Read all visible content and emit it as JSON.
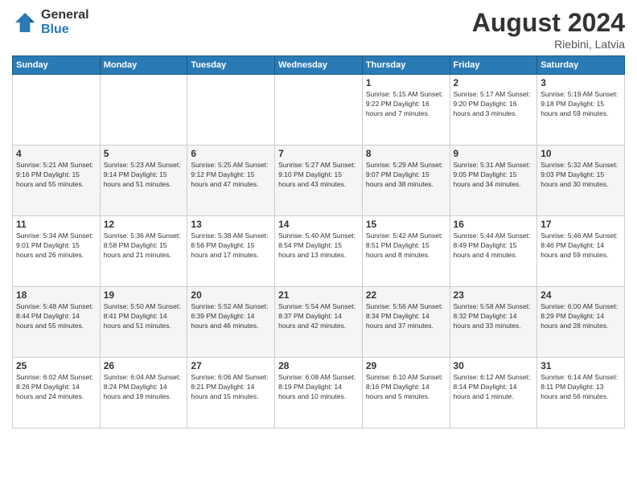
{
  "logo": {
    "general": "General",
    "blue": "Blue"
  },
  "title": {
    "month_year": "August 2024",
    "location": "Riebini, Latvia"
  },
  "headers": [
    "Sunday",
    "Monday",
    "Tuesday",
    "Wednesday",
    "Thursday",
    "Friday",
    "Saturday"
  ],
  "weeks": [
    [
      {
        "day": "",
        "info": ""
      },
      {
        "day": "",
        "info": ""
      },
      {
        "day": "",
        "info": ""
      },
      {
        "day": "",
        "info": ""
      },
      {
        "day": "1",
        "info": "Sunrise: 5:15 AM\nSunset: 9:22 PM\nDaylight: 16 hours\nand 7 minutes."
      },
      {
        "day": "2",
        "info": "Sunrise: 5:17 AM\nSunset: 9:20 PM\nDaylight: 16 hours\nand 3 minutes."
      },
      {
        "day": "3",
        "info": "Sunrise: 5:19 AM\nSunset: 9:18 PM\nDaylight: 15 hours\nand 59 minutes."
      }
    ],
    [
      {
        "day": "4",
        "info": "Sunrise: 5:21 AM\nSunset: 9:16 PM\nDaylight: 15 hours\nand 55 minutes."
      },
      {
        "day": "5",
        "info": "Sunrise: 5:23 AM\nSunset: 9:14 PM\nDaylight: 15 hours\nand 51 minutes."
      },
      {
        "day": "6",
        "info": "Sunrise: 5:25 AM\nSunset: 9:12 PM\nDaylight: 15 hours\nand 47 minutes."
      },
      {
        "day": "7",
        "info": "Sunrise: 5:27 AM\nSunset: 9:10 PM\nDaylight: 15 hours\nand 43 minutes."
      },
      {
        "day": "8",
        "info": "Sunrise: 5:29 AM\nSunset: 9:07 PM\nDaylight: 15 hours\nand 38 minutes."
      },
      {
        "day": "9",
        "info": "Sunrise: 5:31 AM\nSunset: 9:05 PM\nDaylight: 15 hours\nand 34 minutes."
      },
      {
        "day": "10",
        "info": "Sunrise: 5:32 AM\nSunset: 9:03 PM\nDaylight: 15 hours\nand 30 minutes."
      }
    ],
    [
      {
        "day": "11",
        "info": "Sunrise: 5:34 AM\nSunset: 9:01 PM\nDaylight: 15 hours\nand 26 minutes."
      },
      {
        "day": "12",
        "info": "Sunrise: 5:36 AM\nSunset: 8:58 PM\nDaylight: 15 hours\nand 21 minutes."
      },
      {
        "day": "13",
        "info": "Sunrise: 5:38 AM\nSunset: 8:56 PM\nDaylight: 15 hours\nand 17 minutes."
      },
      {
        "day": "14",
        "info": "Sunrise: 5:40 AM\nSunset: 8:54 PM\nDaylight: 15 hours\nand 13 minutes."
      },
      {
        "day": "15",
        "info": "Sunrise: 5:42 AM\nSunset: 8:51 PM\nDaylight: 15 hours\nand 8 minutes."
      },
      {
        "day": "16",
        "info": "Sunrise: 5:44 AM\nSunset: 8:49 PM\nDaylight: 15 hours\nand 4 minutes."
      },
      {
        "day": "17",
        "info": "Sunrise: 5:46 AM\nSunset: 8:46 PM\nDaylight: 14 hours\nand 59 minutes."
      }
    ],
    [
      {
        "day": "18",
        "info": "Sunrise: 5:48 AM\nSunset: 8:44 PM\nDaylight: 14 hours\nand 55 minutes."
      },
      {
        "day": "19",
        "info": "Sunrise: 5:50 AM\nSunset: 8:41 PM\nDaylight: 14 hours\nand 51 minutes."
      },
      {
        "day": "20",
        "info": "Sunrise: 5:52 AM\nSunset: 8:39 PM\nDaylight: 14 hours\nand 46 minutes."
      },
      {
        "day": "21",
        "info": "Sunrise: 5:54 AM\nSunset: 8:37 PM\nDaylight: 14 hours\nand 42 minutes."
      },
      {
        "day": "22",
        "info": "Sunrise: 5:56 AM\nSunset: 8:34 PM\nDaylight: 14 hours\nand 37 minutes."
      },
      {
        "day": "23",
        "info": "Sunrise: 5:58 AM\nSunset: 8:32 PM\nDaylight: 14 hours\nand 33 minutes."
      },
      {
        "day": "24",
        "info": "Sunrise: 6:00 AM\nSunset: 8:29 PM\nDaylight: 14 hours\nand 28 minutes."
      }
    ],
    [
      {
        "day": "25",
        "info": "Sunrise: 6:02 AM\nSunset: 8:26 PM\nDaylight: 14 hours\nand 24 minutes."
      },
      {
        "day": "26",
        "info": "Sunrise: 6:04 AM\nSunset: 8:24 PM\nDaylight: 14 hours\nand 19 minutes."
      },
      {
        "day": "27",
        "info": "Sunrise: 6:06 AM\nSunset: 8:21 PM\nDaylight: 14 hours\nand 15 minutes."
      },
      {
        "day": "28",
        "info": "Sunrise: 6:08 AM\nSunset: 8:19 PM\nDaylight: 14 hours\nand 10 minutes."
      },
      {
        "day": "29",
        "info": "Sunrise: 6:10 AM\nSunset: 8:16 PM\nDaylight: 14 hours\nand 5 minutes."
      },
      {
        "day": "30",
        "info": "Sunrise: 6:12 AM\nSunset: 8:14 PM\nDaylight: 14 hours\nand 1 minute."
      },
      {
        "day": "31",
        "info": "Sunrise: 6:14 AM\nSunset: 8:11 PM\nDaylight: 13 hours\nand 56 minutes."
      }
    ]
  ]
}
